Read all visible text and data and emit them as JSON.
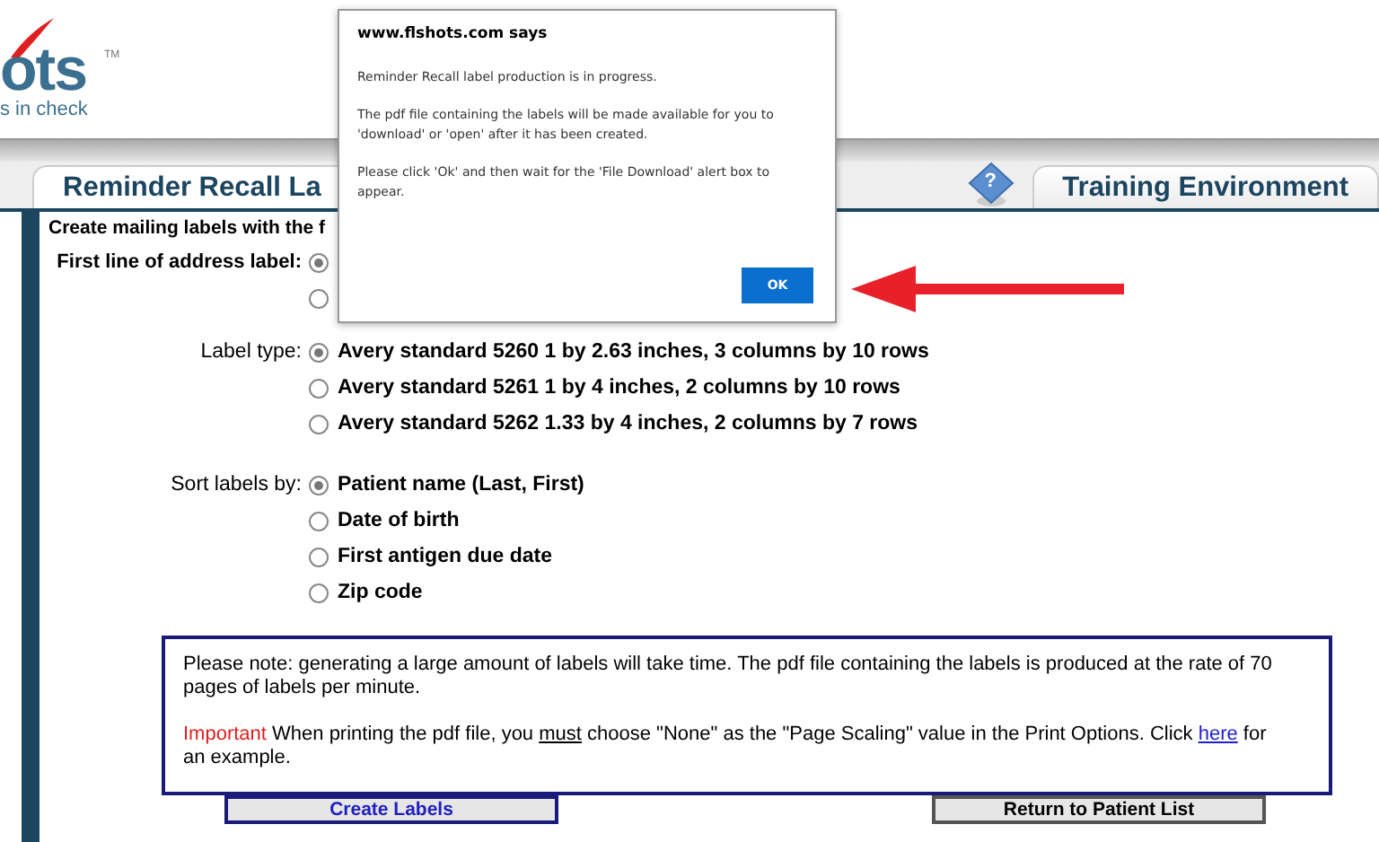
{
  "logo": {
    "wordmark": "ots",
    "trademark": "TM",
    "tagline": "s in check"
  },
  "help": "?",
  "tabs": [
    {
      "label": "Reminder Recall La",
      "selected": true
    },
    {
      "label": "Training Environment",
      "selected": false
    }
  ],
  "intro": "Create mailing labels with the f",
  "groups": [
    {
      "label": "First line of address label:",
      "options": [
        {
          "selected": true
        },
        {
          "selected": false
        }
      ]
    },
    {
      "label": "Label type:",
      "options": [
        {
          "text": "Avery standard 5260 1 by 2.63 inches, 3 columns by 10 rows",
          "selected": true
        },
        {
          "text": "Avery standard 5261 1 by 4 inches, 2 columns by 10 rows",
          "selected": false
        },
        {
          "text": "Avery standard 5262 1.33 by 4 inches, 2 columns by 7 rows",
          "selected": false
        }
      ]
    },
    {
      "label": "Sort labels by:",
      "options": [
        {
          "text": "Patient name (Last, First)",
          "selected": true
        },
        {
          "text": "Date of birth",
          "selected": false
        },
        {
          "text": "First antigen due date",
          "selected": false
        },
        {
          "text": "Zip code",
          "selected": false
        }
      ]
    }
  ],
  "note": {
    "paragraph": "Please note: generating a large amount of labels will take time.  The pdf file containing the labels is produced at the rate of 70 pages of labels per minute.",
    "important": "Important",
    "before_must": " When printing the pdf file, you ",
    "must": "must",
    "after_must": " choose \"None\" as the \"Page Scaling\" value in the Print Options.  Click ",
    "link": "here",
    "tail": " for an example."
  },
  "buttons": [
    {
      "label": "Create Labels",
      "kind": "primary"
    },
    {
      "label": "Return to Patient List",
      "kind": "secondary"
    }
  ],
  "dialog": {
    "title": "www.flshots.com says",
    "messages": [
      "Reminder Recall label production is in progress.",
      "The pdf file containing the labels will be made available for you to 'download' or 'open' after it has been created.",
      "Please click 'Ok' and then wait for the 'File Download' alert box to appear."
    ],
    "ok": "OK"
  }
}
